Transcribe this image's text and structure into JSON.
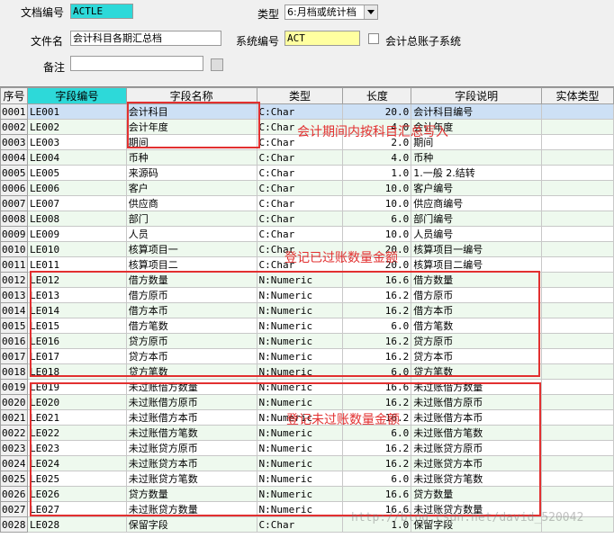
{
  "form": {
    "doc_code_label": "文档编号",
    "doc_code_value": "ACTLE",
    "type_label": "类型",
    "type_value": "6:月档或统计档",
    "doc_name_label": "文件名",
    "doc_name_value": "会计科目各期汇总档",
    "sys_code_label": "系统编号",
    "sys_code_value": "ACT",
    "sys_name": "会计总账子系统",
    "remark_label": "备注",
    "remark_value": ""
  },
  "table": {
    "headers": [
      "序号",
      "字段编号",
      "字段名称",
      "类型",
      "长度",
      "字段说明",
      "实体类型"
    ],
    "rows": [
      [
        "0001",
        "LE001",
        "会计科目",
        "C:Char",
        "20.0",
        "会计科目编号"
      ],
      [
        "0002",
        "LE002",
        "会计年度",
        "C:Char",
        "4.0",
        "会计年度"
      ],
      [
        "0003",
        "LE003",
        "期间",
        "C:Char",
        "2.0",
        "期间"
      ],
      [
        "0004",
        "LE004",
        "币种",
        "C:Char",
        "4.0",
        "币种"
      ],
      [
        "0005",
        "LE005",
        "来源码",
        "C:Char",
        "1.0",
        "1.一般 2.结转"
      ],
      [
        "0006",
        "LE006",
        "客户",
        "C:Char",
        "10.0",
        "客户编号"
      ],
      [
        "0007",
        "LE007",
        "供应商",
        "C:Char",
        "10.0",
        "供应商编号"
      ],
      [
        "0008",
        "LE008",
        "部门",
        "C:Char",
        "6.0",
        "部门编号"
      ],
      [
        "0009",
        "LE009",
        "人员",
        "C:Char",
        "10.0",
        "人员编号"
      ],
      [
        "0010",
        "LE010",
        "核算项目一",
        "C:Char",
        "20.0",
        "核算项目一编号"
      ],
      [
        "0011",
        "LE011",
        "核算项目二",
        "C:Char",
        "20.0",
        "核算项目二编号"
      ],
      [
        "0012",
        "LE012",
        "借方数量",
        "N:Numeric",
        "16.6",
        "借方数量"
      ],
      [
        "0013",
        "LE013",
        "借方原币",
        "N:Numeric",
        "16.2",
        "借方原币"
      ],
      [
        "0014",
        "LE014",
        "借方本币",
        "N:Numeric",
        "16.2",
        "借方本币"
      ],
      [
        "0015",
        "LE015",
        "借方笔数",
        "N:Numeric",
        "6.0",
        "借方笔数"
      ],
      [
        "0016",
        "LE016",
        "贷方原币",
        "N:Numeric",
        "16.2",
        "贷方原币"
      ],
      [
        "0017",
        "LE017",
        "贷方本币",
        "N:Numeric",
        "16.2",
        "贷方本币"
      ],
      [
        "0018",
        "LE018",
        "贷方笔数",
        "N:Numeric",
        "6.0",
        "贷方笔数"
      ],
      [
        "0019",
        "LE019",
        "未过账借方数量",
        "N:Numeric",
        "16.6",
        "未过账借方数量"
      ],
      [
        "0020",
        "LE020",
        "未过账借方原币",
        "N:Numeric",
        "16.2",
        "未过账借方原币"
      ],
      [
        "0021",
        "LE021",
        "未过账借方本币",
        "N:Numeric",
        "16.2",
        "未过账借方本币"
      ],
      [
        "0022",
        "LE022",
        "未过账借方笔数",
        "N:Numeric",
        "6.0",
        "未过账借方笔数"
      ],
      [
        "0023",
        "LE023",
        "未过账贷方原币",
        "N:Numeric",
        "16.2",
        "未过账贷方原币"
      ],
      [
        "0024",
        "LE024",
        "未过账贷方本币",
        "N:Numeric",
        "16.2",
        "未过账贷方本币"
      ],
      [
        "0025",
        "LE025",
        "未过账贷方笔数",
        "N:Numeric",
        "6.0",
        "未过账贷方笔数"
      ],
      [
        "0026",
        "LE026",
        "贷方数量",
        "N:Numeric",
        "16.6",
        "贷方数量"
      ],
      [
        "0027",
        "LE027",
        "未过账贷方数量",
        "N:Numeric",
        "16.6",
        "未过账贷方数量"
      ],
      [
        "0028",
        "LE028",
        "保留字段",
        "C:Char",
        "1.0",
        "保留字段"
      ]
    ]
  },
  "annotations": {
    "box1": "会计期间内按科目汇总写入",
    "box2": "登记已过账数量金额",
    "box3": "登记未过账数量金额"
  },
  "watermark": "http://blog.csdn.net/david_520042",
  "colors": {
    "highlight_field": "#2dd9d9",
    "readonly_field": "#ffffa0",
    "annotation_red": "#e23030",
    "selected_row": "#cde0f5",
    "alt_row": "#eef9ee"
  }
}
